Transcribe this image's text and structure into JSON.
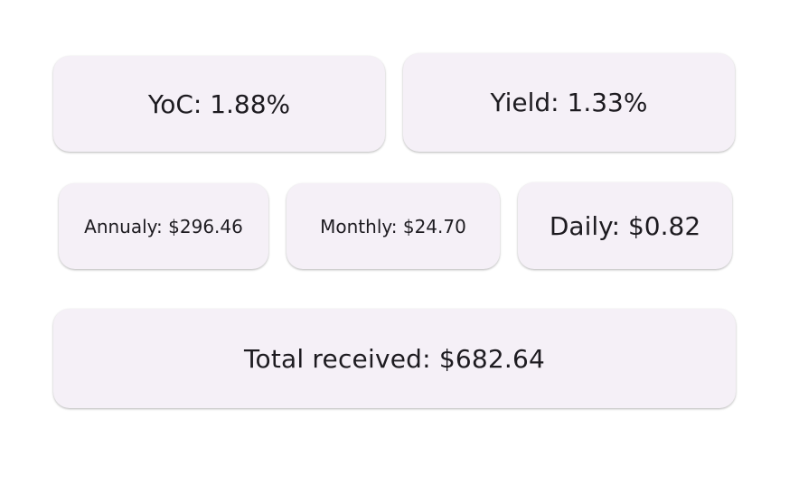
{
  "stats": {
    "yoc": "YoC: 1.88%",
    "yield": "Yield: 1.33%",
    "annually": "Annualy: $296.46",
    "monthly": "Monthly: $24.70",
    "daily": "Daily: $0.82",
    "total_received": "Total received: $682.64"
  },
  "colors": {
    "card_background": "#f5f0f7",
    "text": "#1d1b20",
    "page_background": "#ffffff"
  }
}
